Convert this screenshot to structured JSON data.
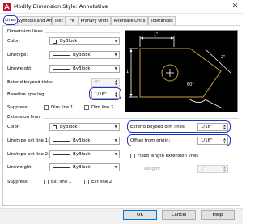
{
  "window": {
    "title": "Modify Dimension Style: Annotative",
    "close_glyph": "✕"
  },
  "tabs": [
    {
      "label": "Lines",
      "active": true
    },
    {
      "label": "Symbols and Arrows"
    },
    {
      "label": "Text"
    },
    {
      "label": "Fit"
    },
    {
      "label": "Primary Units"
    },
    {
      "label": "Alternate Units"
    },
    {
      "label": "Tolerances"
    }
  ],
  "dimension_lines": {
    "title": "Dimension lines",
    "color_label": "Color:",
    "color_value": "ByBlock",
    "linetype_label": "Linetype:",
    "linetype_value": "ByBlock",
    "lineweight_label": "Lineweight:",
    "lineweight_value": "ByBlock",
    "extend_ticks_label": "Extend beyond ticks:",
    "extend_ticks_value": "0\"",
    "baseline_spacing_label": "Baseline spacing:",
    "baseline_spacing_value": "1/16\"",
    "suppress_label": "Suppress:",
    "dim_line_1": "Dim line 1",
    "dim_line_2": "Dim line 2"
  },
  "extension_lines": {
    "title": "Extension lines",
    "color_label": "Color:",
    "color_value": "ByBlock",
    "ext1_linetype_label": "Linetype ext line 1:",
    "ext1_linetype_value": "ByBlock",
    "ext2_linetype_label": "Linetype ext line 2:",
    "ext2_linetype_value": "ByBlock",
    "lineweight_label": "Lineweight:",
    "lineweight_value": "ByBlock",
    "suppress_label": "Suppress:",
    "ext_line_1": "Ext line 1",
    "ext_line_2": "Ext line 2",
    "extend_beyond_label": "Extend beyond dim lines:",
    "extend_beyond_value": "1/16\"",
    "offset_label": "Offset from origin:",
    "offset_value": "1/16\"",
    "fixed_length_label": "Fixed length extension lines",
    "length_label": "Length:",
    "length_value": "1\""
  },
  "preview": {
    "dim_top": "1\"",
    "dim_left": "1\"",
    "dim_right": "2\"",
    "dim_angle": "60°"
  },
  "buttons": {
    "ok": "OK",
    "cancel": "Cancel",
    "help": "Help"
  },
  "colors": {
    "highlight": "#1e33c9",
    "preview_bg": "#000000",
    "preview_shape": "#c8a040"
  },
  "icons": {
    "app": "autocad-app-icon",
    "close": "close-icon",
    "spinner": "spinner-arrows-icon",
    "dropdown": "chevron-down-icon"
  }
}
